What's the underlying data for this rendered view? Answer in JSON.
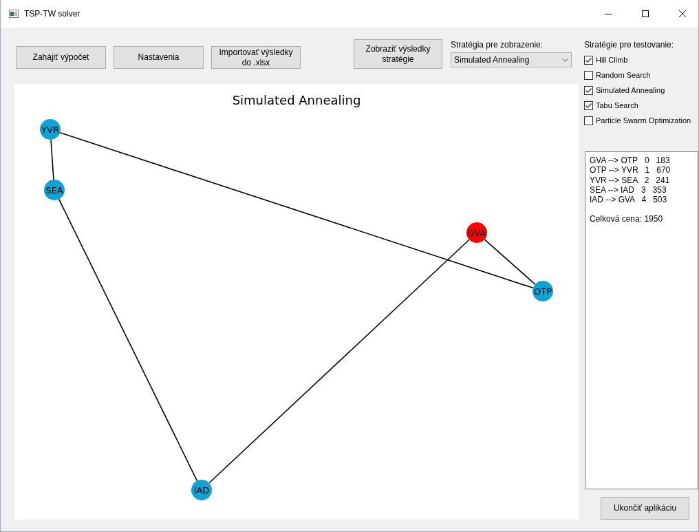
{
  "window": {
    "title": "TSP-TW solver"
  },
  "toolbar": {
    "buttons": [
      {
        "label": "Zahájiť výpočet"
      },
      {
        "label": "Nastavenia"
      },
      {
        "label": "Importovať výsledky do .xlsx"
      },
      {
        "label": "Zobraziť výsledky stratégie"
      }
    ],
    "display_strategy": {
      "label": "Stratégia pre zobrazenie:",
      "value": "Simulated Annealing"
    }
  },
  "graph": {
    "title": "Simulated Annealing",
    "nodes": [
      {
        "label": "YVR",
        "color": "#0ea2d6"
      },
      {
        "label": "SEA",
        "color": "#0ea2d6"
      },
      {
        "label": "GVA",
        "color": "#ff0000"
      },
      {
        "label": "OTP",
        "color": "#0ea2d6"
      },
      {
        "label": "IAD",
        "color": "#0ea2d6"
      }
    ]
  },
  "test_strategies": {
    "label": "Stratégie pre testovanie:",
    "items": [
      {
        "label": "Hill Climb",
        "checked": true
      },
      {
        "label": "Random Search",
        "checked": false
      },
      {
        "label": "Simulated Annealing",
        "checked": true
      },
      {
        "label": "Tabu Search",
        "checked": true
      },
      {
        "label": "Particle Swarm Optimization",
        "checked": false
      }
    ]
  },
  "results": {
    "lines": [
      "GVA --> OTP   0   183",
      "OTP --> YVR   1   670",
      "YVR --> SEA   2   241",
      "SEA --> IAD   3   353",
      "IAD --> GVA   4   503"
    ],
    "total": "Celková cena: 1950"
  },
  "exit_button": {
    "label": "Ukončiť aplikáciu"
  }
}
